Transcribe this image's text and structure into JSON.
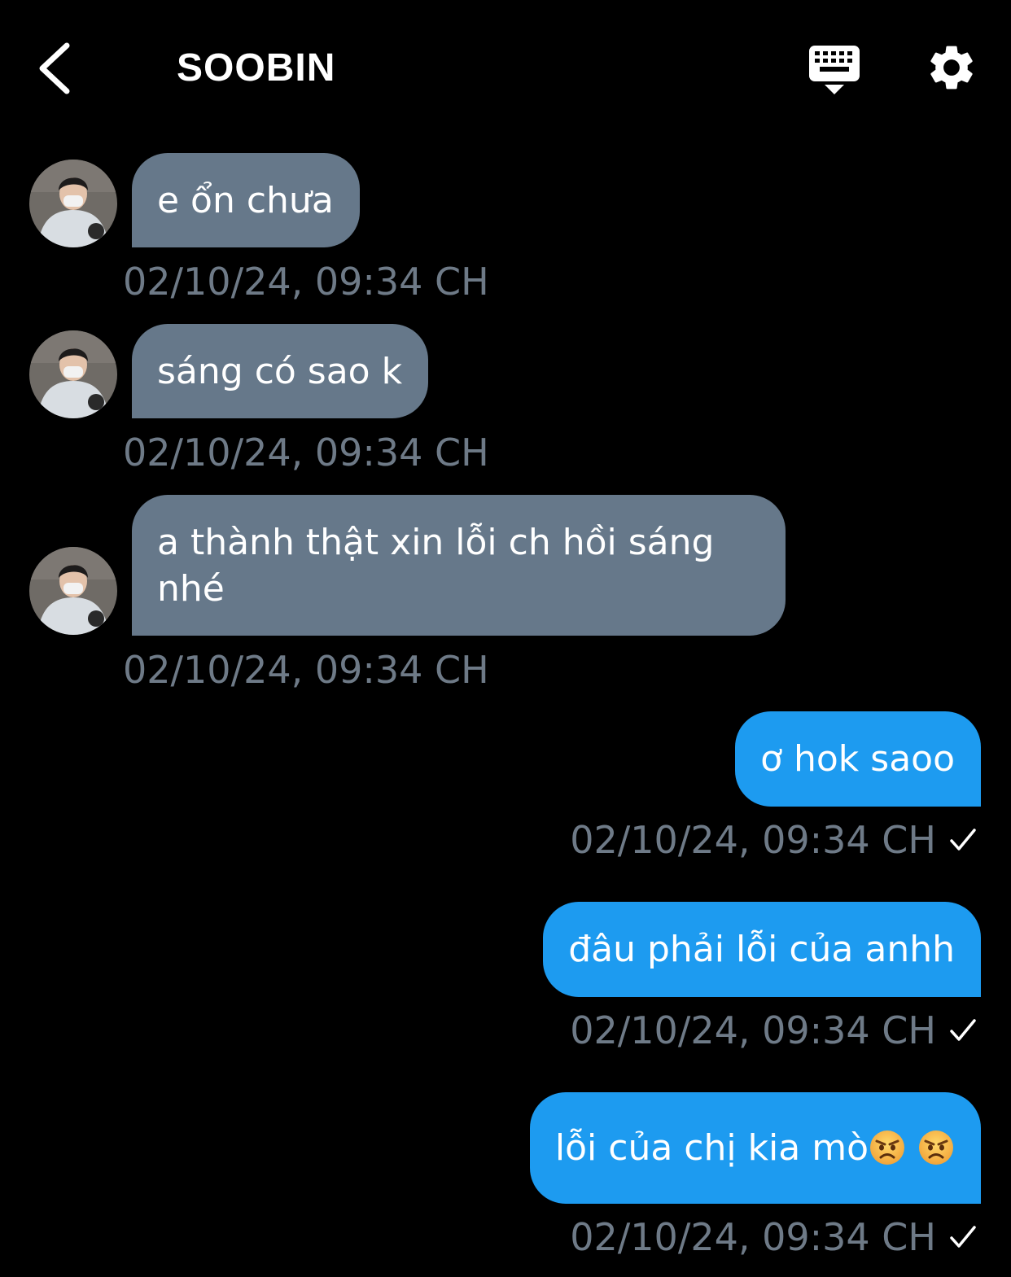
{
  "header": {
    "title": "SOOBIN",
    "back_icon": "chevron-left-icon",
    "keyboard_icon": "keyboard-hide-icon",
    "settings_icon": "gear-icon"
  },
  "colors": {
    "background": "#000000",
    "incoming_bubble": "#66788a",
    "outgoing_bubble": "#1d9bf0",
    "timestamp": "#6e7a87"
  },
  "messages": [
    {
      "direction": "incoming",
      "text": "e ổn chưa",
      "time": "02/10/24, 09:34 CH"
    },
    {
      "direction": "incoming",
      "text": "sáng có sao k",
      "time": "02/10/24, 09:34 CH"
    },
    {
      "direction": "incoming",
      "text": "a thành thật xin lỗi ch hồi sáng nhé",
      "time": "02/10/24, 09:34 CH"
    },
    {
      "direction": "outgoing",
      "text": "ơ hok saoo",
      "time": "02/10/24, 09:34 CH",
      "status_icon": "check-icon"
    },
    {
      "direction": "outgoing",
      "text": "đâu phải lỗi của anhh",
      "time": "02/10/24, 09:34 CH",
      "status_icon": "check-icon"
    },
    {
      "direction": "outgoing",
      "text": "lỗi của chị kia mò",
      "emojis": [
        "angry-face-emoji",
        "angry-face-emoji"
      ],
      "time": "02/10/24, 09:34 CH",
      "status_icon": "check-icon"
    }
  ]
}
